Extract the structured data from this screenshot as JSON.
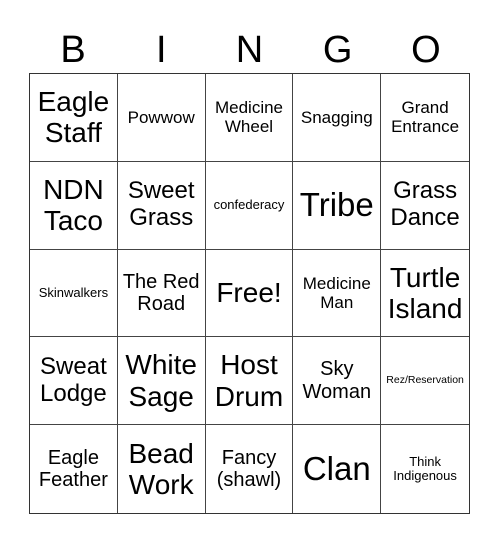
{
  "header": [
    "B",
    "I",
    "N",
    "G",
    "O"
  ],
  "cells": [
    {
      "text": "Eagle Staff",
      "size": "s-l"
    },
    {
      "text": "Powwow",
      "size": "s-s"
    },
    {
      "text": "Medicine Wheel",
      "size": "s-s"
    },
    {
      "text": "Snagging",
      "size": "s-s"
    },
    {
      "text": "Grand Entrance",
      "size": "s-s"
    },
    {
      "text": "NDN Taco",
      "size": "s-l"
    },
    {
      "text": "Sweet Grass",
      "size": "s-m"
    },
    {
      "text": "confederacy",
      "size": "s-xs"
    },
    {
      "text": "Tribe",
      "size": "s-xl"
    },
    {
      "text": "Grass Dance",
      "size": "s-m"
    },
    {
      "text": "Skinwalkers",
      "size": "s-xs"
    },
    {
      "text": "The Red Road",
      "size": "s-n"
    },
    {
      "text": "Free!",
      "size": "s-l"
    },
    {
      "text": "Medicine Man",
      "size": "s-s"
    },
    {
      "text": "Turtle Island",
      "size": "s-l"
    },
    {
      "text": "Sweat Lodge",
      "size": "s-m"
    },
    {
      "text": "White Sage",
      "size": "s-l"
    },
    {
      "text": "Host Drum",
      "size": "s-l"
    },
    {
      "text": "Sky Woman",
      "size": "s-n"
    },
    {
      "text": "Rez/Reservation",
      "size": "s-xxs"
    },
    {
      "text": "Eagle Feather",
      "size": "s-n"
    },
    {
      "text": "Bead Work",
      "size": "s-l"
    },
    {
      "text": "Fancy (shawl)",
      "size": "s-n"
    },
    {
      "text": "Clan",
      "size": "s-xl"
    },
    {
      "text": "Think Indigenous",
      "size": "s-xs"
    }
  ]
}
